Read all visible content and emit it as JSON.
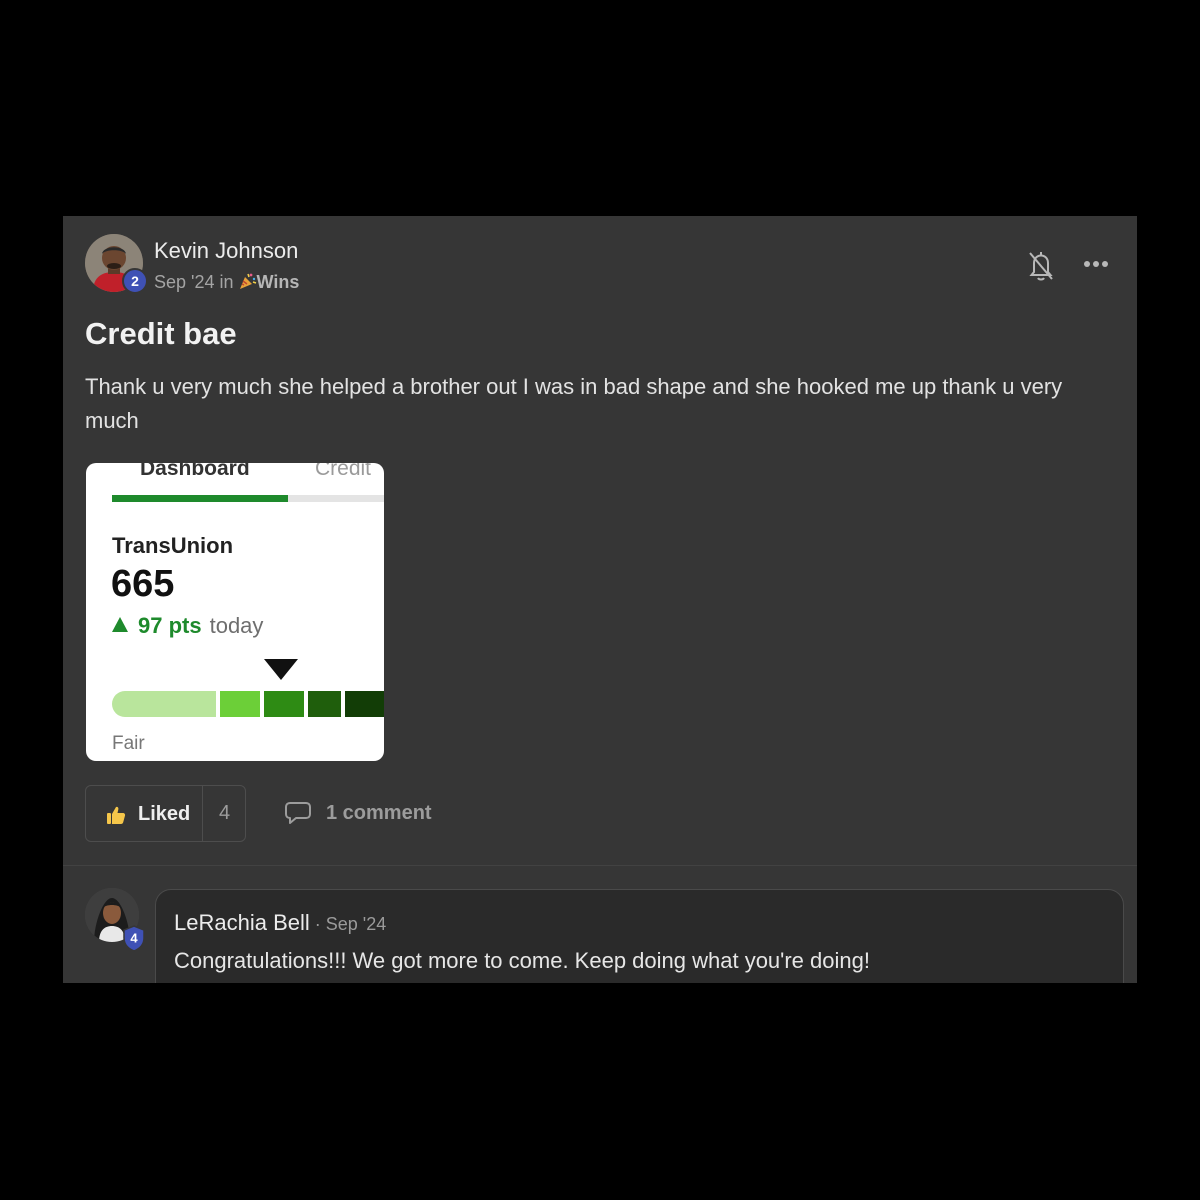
{
  "post": {
    "author": "Kevin Johnson",
    "author_level": "2",
    "meta_prefix": "Sep '24 in",
    "category": "Wins",
    "title": "Credit bae",
    "body": "Thank u very much she helped a brother out I was in bad shape and she hooked me up thank u very much"
  },
  "attachment": {
    "tab_active": "Dashboard",
    "tab_inactive": "Credit",
    "bureau": "TransUnion",
    "score": "665",
    "change": "97 pts",
    "change_when": "today",
    "range_label": "Fair",
    "score_level_fraction": 0.62,
    "band_colors": [
      "#b9e59c",
      "#6ccf38",
      "#2e8b14",
      "#1f5e0c",
      "#123d06"
    ]
  },
  "actions": {
    "like_label": "Liked",
    "like_count": "4",
    "comment_label": "1 comment"
  },
  "comment": {
    "author": "LeRachia Bell",
    "author_level": "4",
    "date": "Sep '24",
    "text": "Congratulations!!! We got more to come. Keep doing what you're doing!"
  },
  "icons": {
    "bell": "bell-off-icon",
    "more": "more-horizontal-icon",
    "like": "thumbs-up-icon",
    "comment": "comment-bubble-icon",
    "category": "party-popper-icon"
  },
  "colors": {
    "accent_green": "#1e8a2c",
    "badge_blue": "#3f51b5",
    "like_yellow": "#f5c64a"
  }
}
